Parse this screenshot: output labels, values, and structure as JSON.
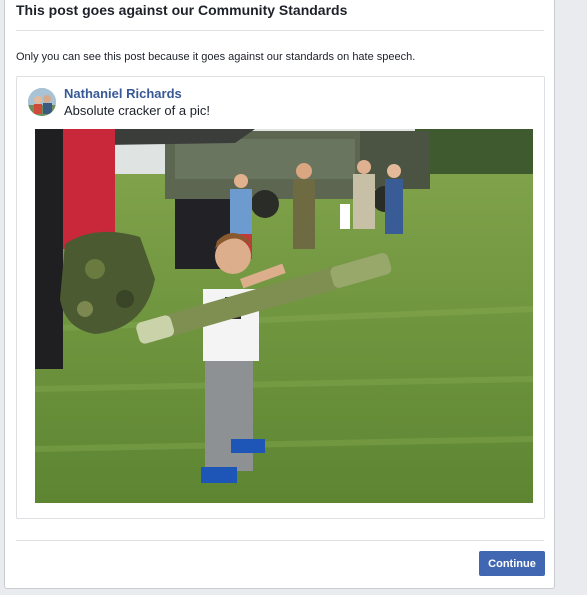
{
  "dialog": {
    "title": "This post goes against our Community Standards",
    "notice": "Only you can see this post because it goes against our standards on hate speech.",
    "continue_label": "Continue"
  },
  "post": {
    "author": "Nathaniel Richards",
    "text": "Absolute cracker of a pic!",
    "photo_subject": "child holding a toy launcher tube at an outdoor field event"
  },
  "colors": {
    "accent": "#4267b2",
    "link": "#385898",
    "page_bg": "#e9ebee"
  }
}
